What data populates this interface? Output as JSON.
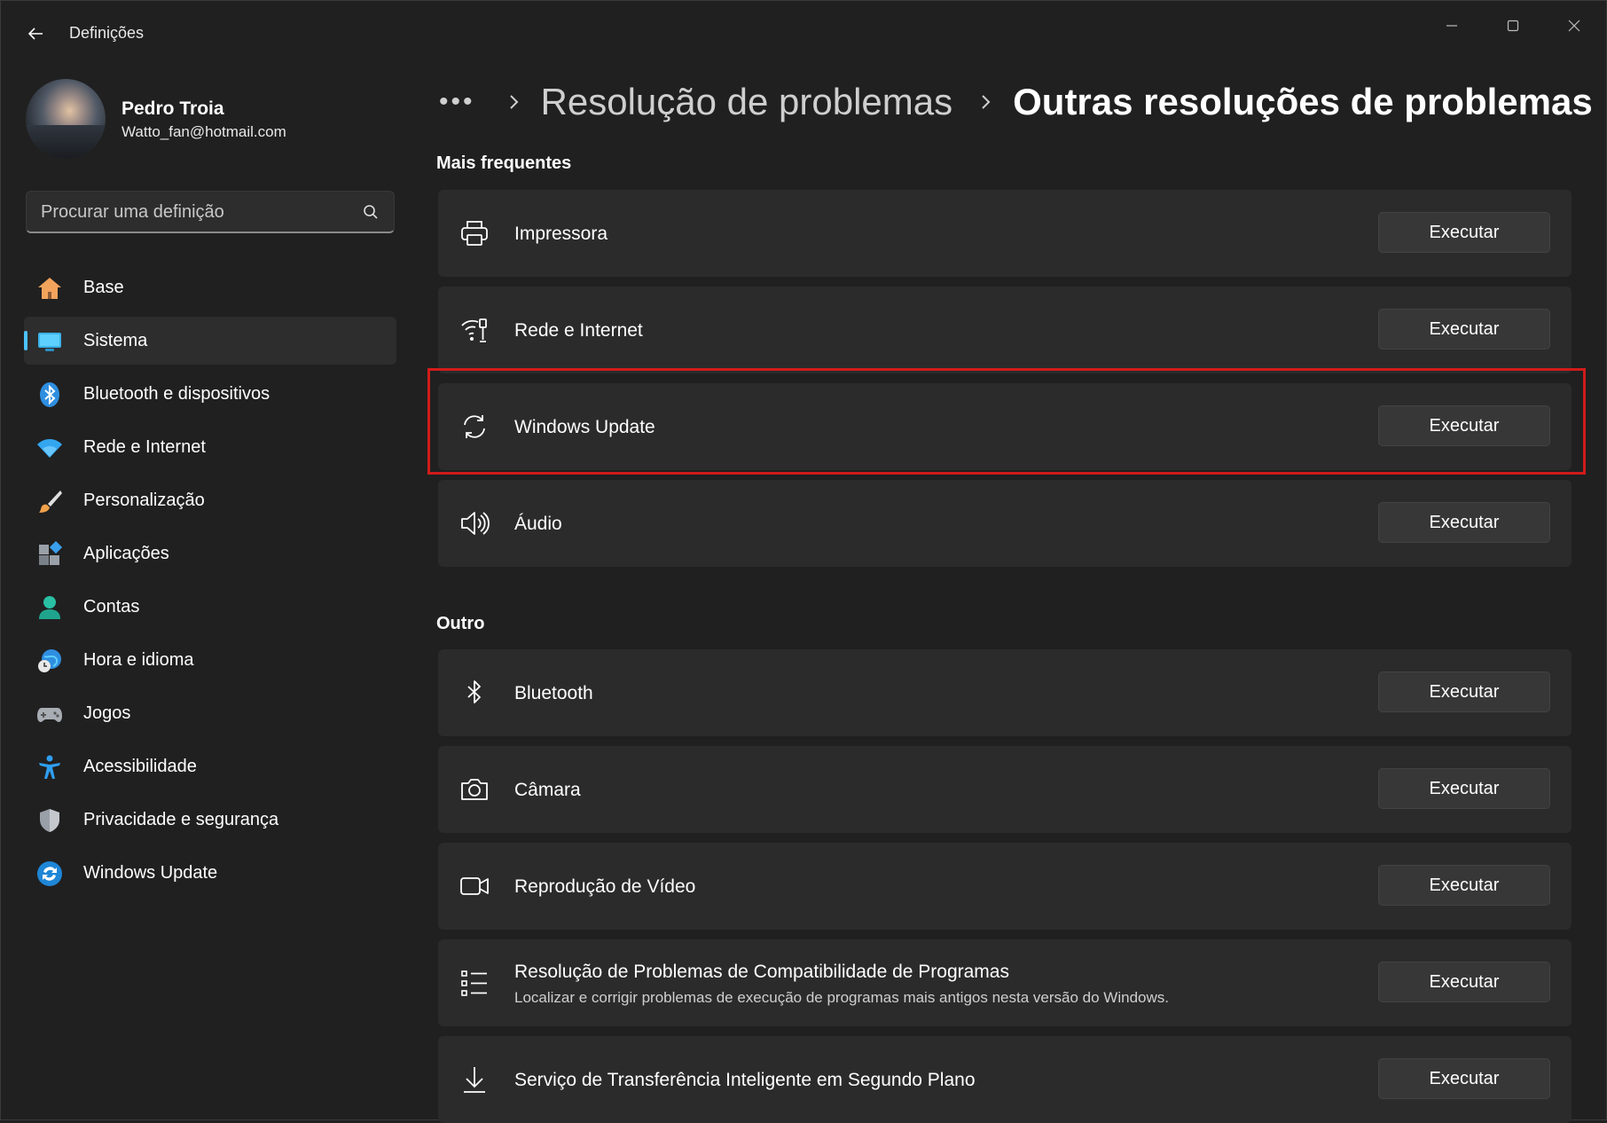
{
  "window": {
    "title": "Definições",
    "back_icon": "back-arrow-icon",
    "controls": [
      "minimize-icon",
      "maximize-icon",
      "close-icon"
    ]
  },
  "profile": {
    "name": "Pedro Troia",
    "email": "Watto_fan@hotmail.com"
  },
  "search": {
    "placeholder": "Procurar uma definição",
    "icon": "search-icon"
  },
  "nav": {
    "items": [
      {
        "label": "Base",
        "icon": "home-icon",
        "active": false
      },
      {
        "label": "Sistema",
        "icon": "monitor-icon",
        "active": true
      },
      {
        "label": "Bluetooth e dispositivos",
        "icon": "bluetooth-icon",
        "active": false
      },
      {
        "label": "Rede e Internet",
        "icon": "wifi-icon",
        "active": false
      },
      {
        "label": "Personalização",
        "icon": "brush-icon",
        "active": false
      },
      {
        "label": "Aplicações",
        "icon": "apps-icon",
        "active": false
      },
      {
        "label": "Contas",
        "icon": "account-icon",
        "active": false
      },
      {
        "label": "Hora e idioma",
        "icon": "clock-globe-icon",
        "active": false
      },
      {
        "label": "Jogos",
        "icon": "gamepad-icon",
        "active": false
      },
      {
        "label": "Acessibilidade",
        "icon": "accessibility-icon",
        "active": false
      },
      {
        "label": "Privacidade e segurança",
        "icon": "shield-icon",
        "active": false
      },
      {
        "label": "Windows Update",
        "icon": "update-icon",
        "active": false
      }
    ],
    "accent_color": "#4cc2ff"
  },
  "breadcrumb": {
    "more": "•••",
    "parent": "Resolução de problemas",
    "current": "Outras resoluções de problemas"
  },
  "sections": {
    "frequent": {
      "title": "Mais frequentes",
      "items": [
        {
          "title": "Impressora",
          "icon": "printer-icon",
          "button": "Executar"
        },
        {
          "title": "Rede e Internet",
          "icon": "network-icon",
          "button": "Executar"
        },
        {
          "title": "Windows Update",
          "icon": "sync-icon",
          "button": "Executar",
          "highlighted": true
        },
        {
          "title": "Áudio",
          "icon": "speaker-icon",
          "button": "Executar"
        }
      ]
    },
    "other": {
      "title": "Outro",
      "items": [
        {
          "title": "Bluetooth",
          "icon": "bluetooth-icon",
          "button": "Executar"
        },
        {
          "title": "Câmara",
          "icon": "camera-icon",
          "button": "Executar"
        },
        {
          "title": "Reprodução de Vídeo",
          "icon": "video-icon",
          "button": "Executar"
        },
        {
          "title": "Resolução de Problemas de Compatibilidade de Programas",
          "subtitle": "Localizar e corrigir problemas de execução de programas mais antigos nesta versão do Windows.",
          "icon": "list-icon",
          "button": "Executar"
        },
        {
          "title": "Serviço de Transferência Inteligente em Segundo Plano",
          "icon": "download-icon",
          "button": "Executar"
        }
      ]
    }
  },
  "colors": {
    "background": "#202020",
    "card": "#2b2b2b",
    "highlight_border": "#d11b1b"
  }
}
